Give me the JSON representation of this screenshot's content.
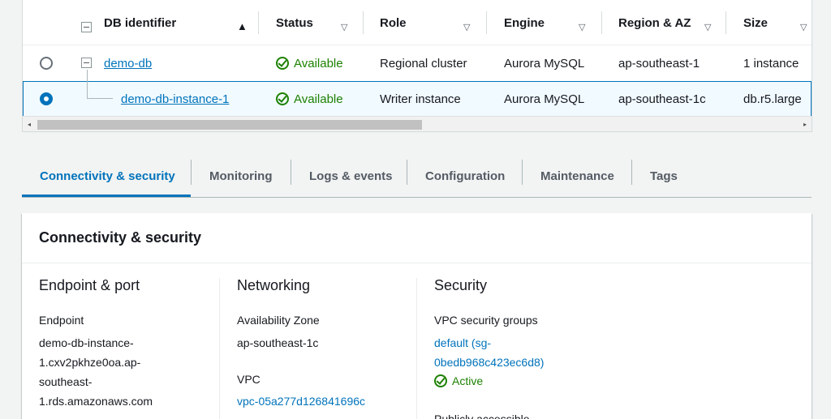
{
  "table": {
    "columns": [
      {
        "label": "DB identifier",
        "sort": "▲"
      },
      {
        "label": "Status",
        "sort": "▽"
      },
      {
        "label": "Role",
        "sort": "▽"
      },
      {
        "label": "Engine",
        "sort": "▽"
      },
      {
        "label": "Region & AZ",
        "sort": "▽"
      },
      {
        "label": "Size",
        "sort": "▽"
      }
    ],
    "rows": [
      {
        "identifier": "demo-db",
        "status": "Available",
        "role": "Regional cluster",
        "engine": "Aurora MySQL",
        "region": "ap-southeast-1",
        "size": "1 instance"
      },
      {
        "identifier": "demo-db-instance-1",
        "status": "Available",
        "role": "Writer instance",
        "engine": "Aurora MySQL",
        "region": "ap-southeast-1c",
        "size": "db.r5.large"
      }
    ],
    "scroll_left": "◂",
    "scroll_right": "▸"
  },
  "tabs": [
    {
      "label": "Connectivity & security"
    },
    {
      "label": "Monitoring"
    },
    {
      "label": "Logs & events"
    },
    {
      "label": "Configuration"
    },
    {
      "label": "Maintenance"
    },
    {
      "label": "Tags"
    }
  ],
  "panel": {
    "title": "Connectivity & security",
    "endpoint": {
      "heading": "Endpoint & port",
      "endpoint_label": "Endpoint",
      "endpoint_lines": [
        "demo-db-instance-",
        "1.cxv2pkhze0oa.ap-",
        "southeast-",
        "1.rds.amazonaws.com"
      ]
    },
    "networking": {
      "heading": "Networking",
      "az_label": "Availability Zone",
      "az_value": "ap-southeast-1c",
      "vpc_label": "VPC",
      "vpc_value": "vpc-05a277d126841696c"
    },
    "security": {
      "heading": "Security",
      "sg_label": "VPC security groups",
      "sg_lines": [
        "default (sg-",
        "0bedb968c423ec6d8)"
      ],
      "sg_status": "Active",
      "public_label": "Publicly accessible"
    }
  },
  "colors": {
    "link": "#0073bb",
    "success": "#1d8102",
    "selected_bg": "#f1faff"
  }
}
